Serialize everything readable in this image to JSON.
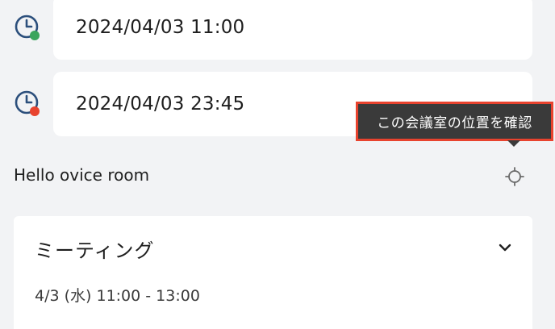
{
  "start": {
    "datetime": "2024/04/03 11:00",
    "status_color": "#3aa55c"
  },
  "end": {
    "datetime": "2024/04/03 23:45",
    "status_color": "#e8432e"
  },
  "tooltip": {
    "text": "この会議室の位置を確認"
  },
  "room": {
    "name": "Hello ovice room"
  },
  "meeting": {
    "title": "ミーティング",
    "time": "4/3 (水) 11:00 - 13:00"
  },
  "icons": {
    "start": "clock-icon",
    "end": "clock-icon",
    "locate": "crosshair-icon",
    "expand": "chevron-down-icon"
  },
  "colors": {
    "icon_blue": "#2c4f7c",
    "highlight_border": "#e8432e",
    "tooltip_bg": "#3a3a3a"
  }
}
